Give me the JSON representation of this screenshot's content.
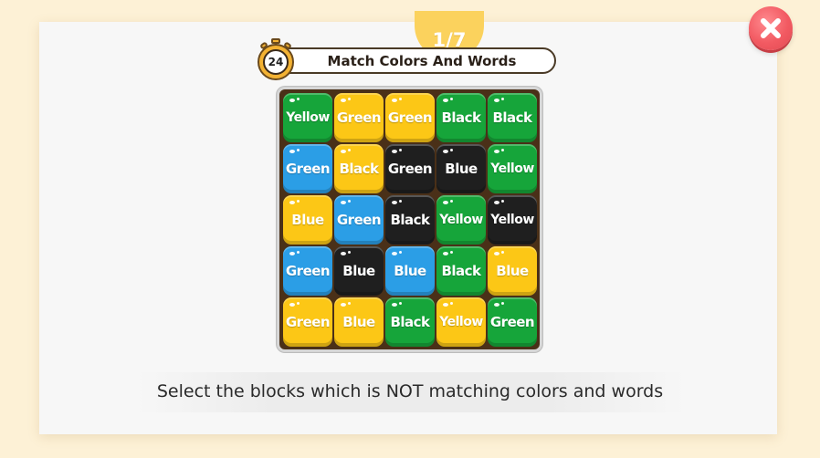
{
  "progress": "1/7",
  "timer": "24",
  "title": "Match Colors And Words",
  "instruction": "Select the blocks which is NOT matching colors and words",
  "colors": {
    "Yellow": "#fcc716",
    "Green": "#16a53a",
    "Blue": "#2b9ee6",
    "Black": "#1f1f1f"
  },
  "grid": [
    [
      {
        "word": "Yellow",
        "color": "Green"
      },
      {
        "word": "Green",
        "color": "Yellow"
      },
      {
        "word": "Green",
        "color": "Yellow"
      },
      {
        "word": "Black",
        "color": "Green"
      },
      {
        "word": "Black",
        "color": "Green"
      }
    ],
    [
      {
        "word": "Green",
        "color": "Blue"
      },
      {
        "word": "Black",
        "color": "Yellow"
      },
      {
        "word": "Green",
        "color": "Black"
      },
      {
        "word": "Blue",
        "color": "Black"
      },
      {
        "word": "Yellow",
        "color": "Green"
      }
    ],
    [
      {
        "word": "Blue",
        "color": "Yellow"
      },
      {
        "word": "Green",
        "color": "Blue"
      },
      {
        "word": "Black",
        "color": "Black"
      },
      {
        "word": "Yellow",
        "color": "Green"
      },
      {
        "word": "Yellow",
        "color": "Black"
      }
    ],
    [
      {
        "word": "Green",
        "color": "Blue"
      },
      {
        "word": "Blue",
        "color": "Black"
      },
      {
        "word": "Blue",
        "color": "Blue"
      },
      {
        "word": "Black",
        "color": "Green"
      },
      {
        "word": "Blue",
        "color": "Yellow"
      }
    ],
    [
      {
        "word": "Green",
        "color": "Yellow"
      },
      {
        "word": "Blue",
        "color": "Yellow"
      },
      {
        "word": "Black",
        "color": "Green"
      },
      {
        "word": "Yellow",
        "color": "Yellow"
      },
      {
        "word": "Green",
        "color": "Green"
      }
    ]
  ],
  "icons": {
    "close": "close-icon",
    "timer": "stopwatch-icon"
  }
}
